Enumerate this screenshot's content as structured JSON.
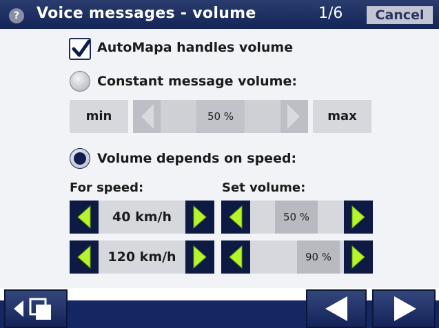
{
  "titlebar": {
    "help_icon": "?",
    "title": "Voice messages - volume",
    "page": "1/6",
    "cancel_label": "Cancel"
  },
  "autovolume": {
    "label": "AutoMapa handles volume",
    "checked": true
  },
  "constant": {
    "label": "Constant message volume:",
    "selected": false,
    "min_label": "min",
    "max_label": "max",
    "value": "50 %"
  },
  "speed_mode": {
    "label": "Volume depends on speed:",
    "selected": true,
    "for_speed_label": "For speed:",
    "set_volume_label": "Set volume:",
    "rows": [
      {
        "speed": "40 km/h",
        "volume": "50 %"
      },
      {
        "speed": "120 km/h",
        "volume": "90 %"
      }
    ]
  },
  "colors": {
    "title_bar": "#142457",
    "arrow_green": "#b6f52a",
    "arrow_button": "#0c1a44"
  }
}
